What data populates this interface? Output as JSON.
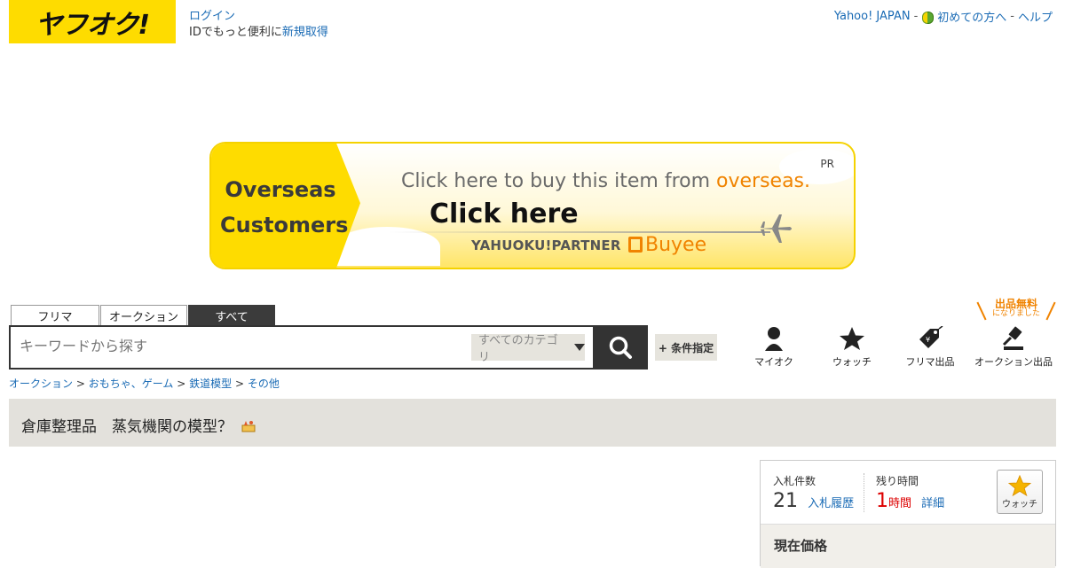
{
  "header": {
    "logo_text": "ヤフオク!",
    "login_label": "ログイン",
    "id_promo_prefix": "IDでもっと便利に",
    "id_promo_link": "新規取得",
    "top_links": {
      "yahoo_japan": "Yahoo! JAPAN",
      "sep1": "-",
      "beginners": "初めての方へ",
      "sep2": "-",
      "help": "ヘルプ"
    }
  },
  "banner": {
    "left_line1": "Overseas",
    "left_line2": "Customers",
    "line1_prefix": "Click here to buy this item from ",
    "line1_highlight": "overseas.",
    "line2": "Click here",
    "partner": "YAHUOKU!PARTNER",
    "buyee": "Buyee",
    "pr": "PR"
  },
  "search": {
    "tabs": [
      "フリマ",
      "オークション",
      "すべて"
    ],
    "active_tab": "すべて",
    "placeholder": "キーワードから探す",
    "category_select": "すべてのカテゴリ",
    "condition_button": "+ 条件指定"
  },
  "shortcuts": {
    "free_listing_line1": "出品無料",
    "free_listing_line2": "になりました",
    "items": [
      {
        "label": "マイオク",
        "icon": "person-icon"
      },
      {
        "label": "ウォッチ",
        "icon": "star-icon"
      },
      {
        "label": "フリマ出品",
        "icon": "price-tag-icon"
      },
      {
        "label": "オークション出品",
        "icon": "gavel-icon"
      }
    ]
  },
  "breadcrumb": {
    "items": [
      "オークション",
      "おもちゃ、ゲーム",
      "鉄道模型",
      "その他"
    ],
    "separator": ">"
  },
  "item": {
    "title": "倉庫整理品　蒸気機関の模型？"
  },
  "bid_panel": {
    "bids_label": "入札件数",
    "bids_count": "21",
    "bid_history_link": "入札履歴",
    "time_label": "残り時間",
    "time_value": "1",
    "time_unit": "時間",
    "details_link": "詳細",
    "watch_label": "ウォッチ",
    "current_price_label": "現在価格"
  },
  "colors": {
    "brand_yellow": "#fedc00",
    "link_blue": "#1a6bb5",
    "accent_orange": "#f08300",
    "alert_red": "#dd0000"
  }
}
